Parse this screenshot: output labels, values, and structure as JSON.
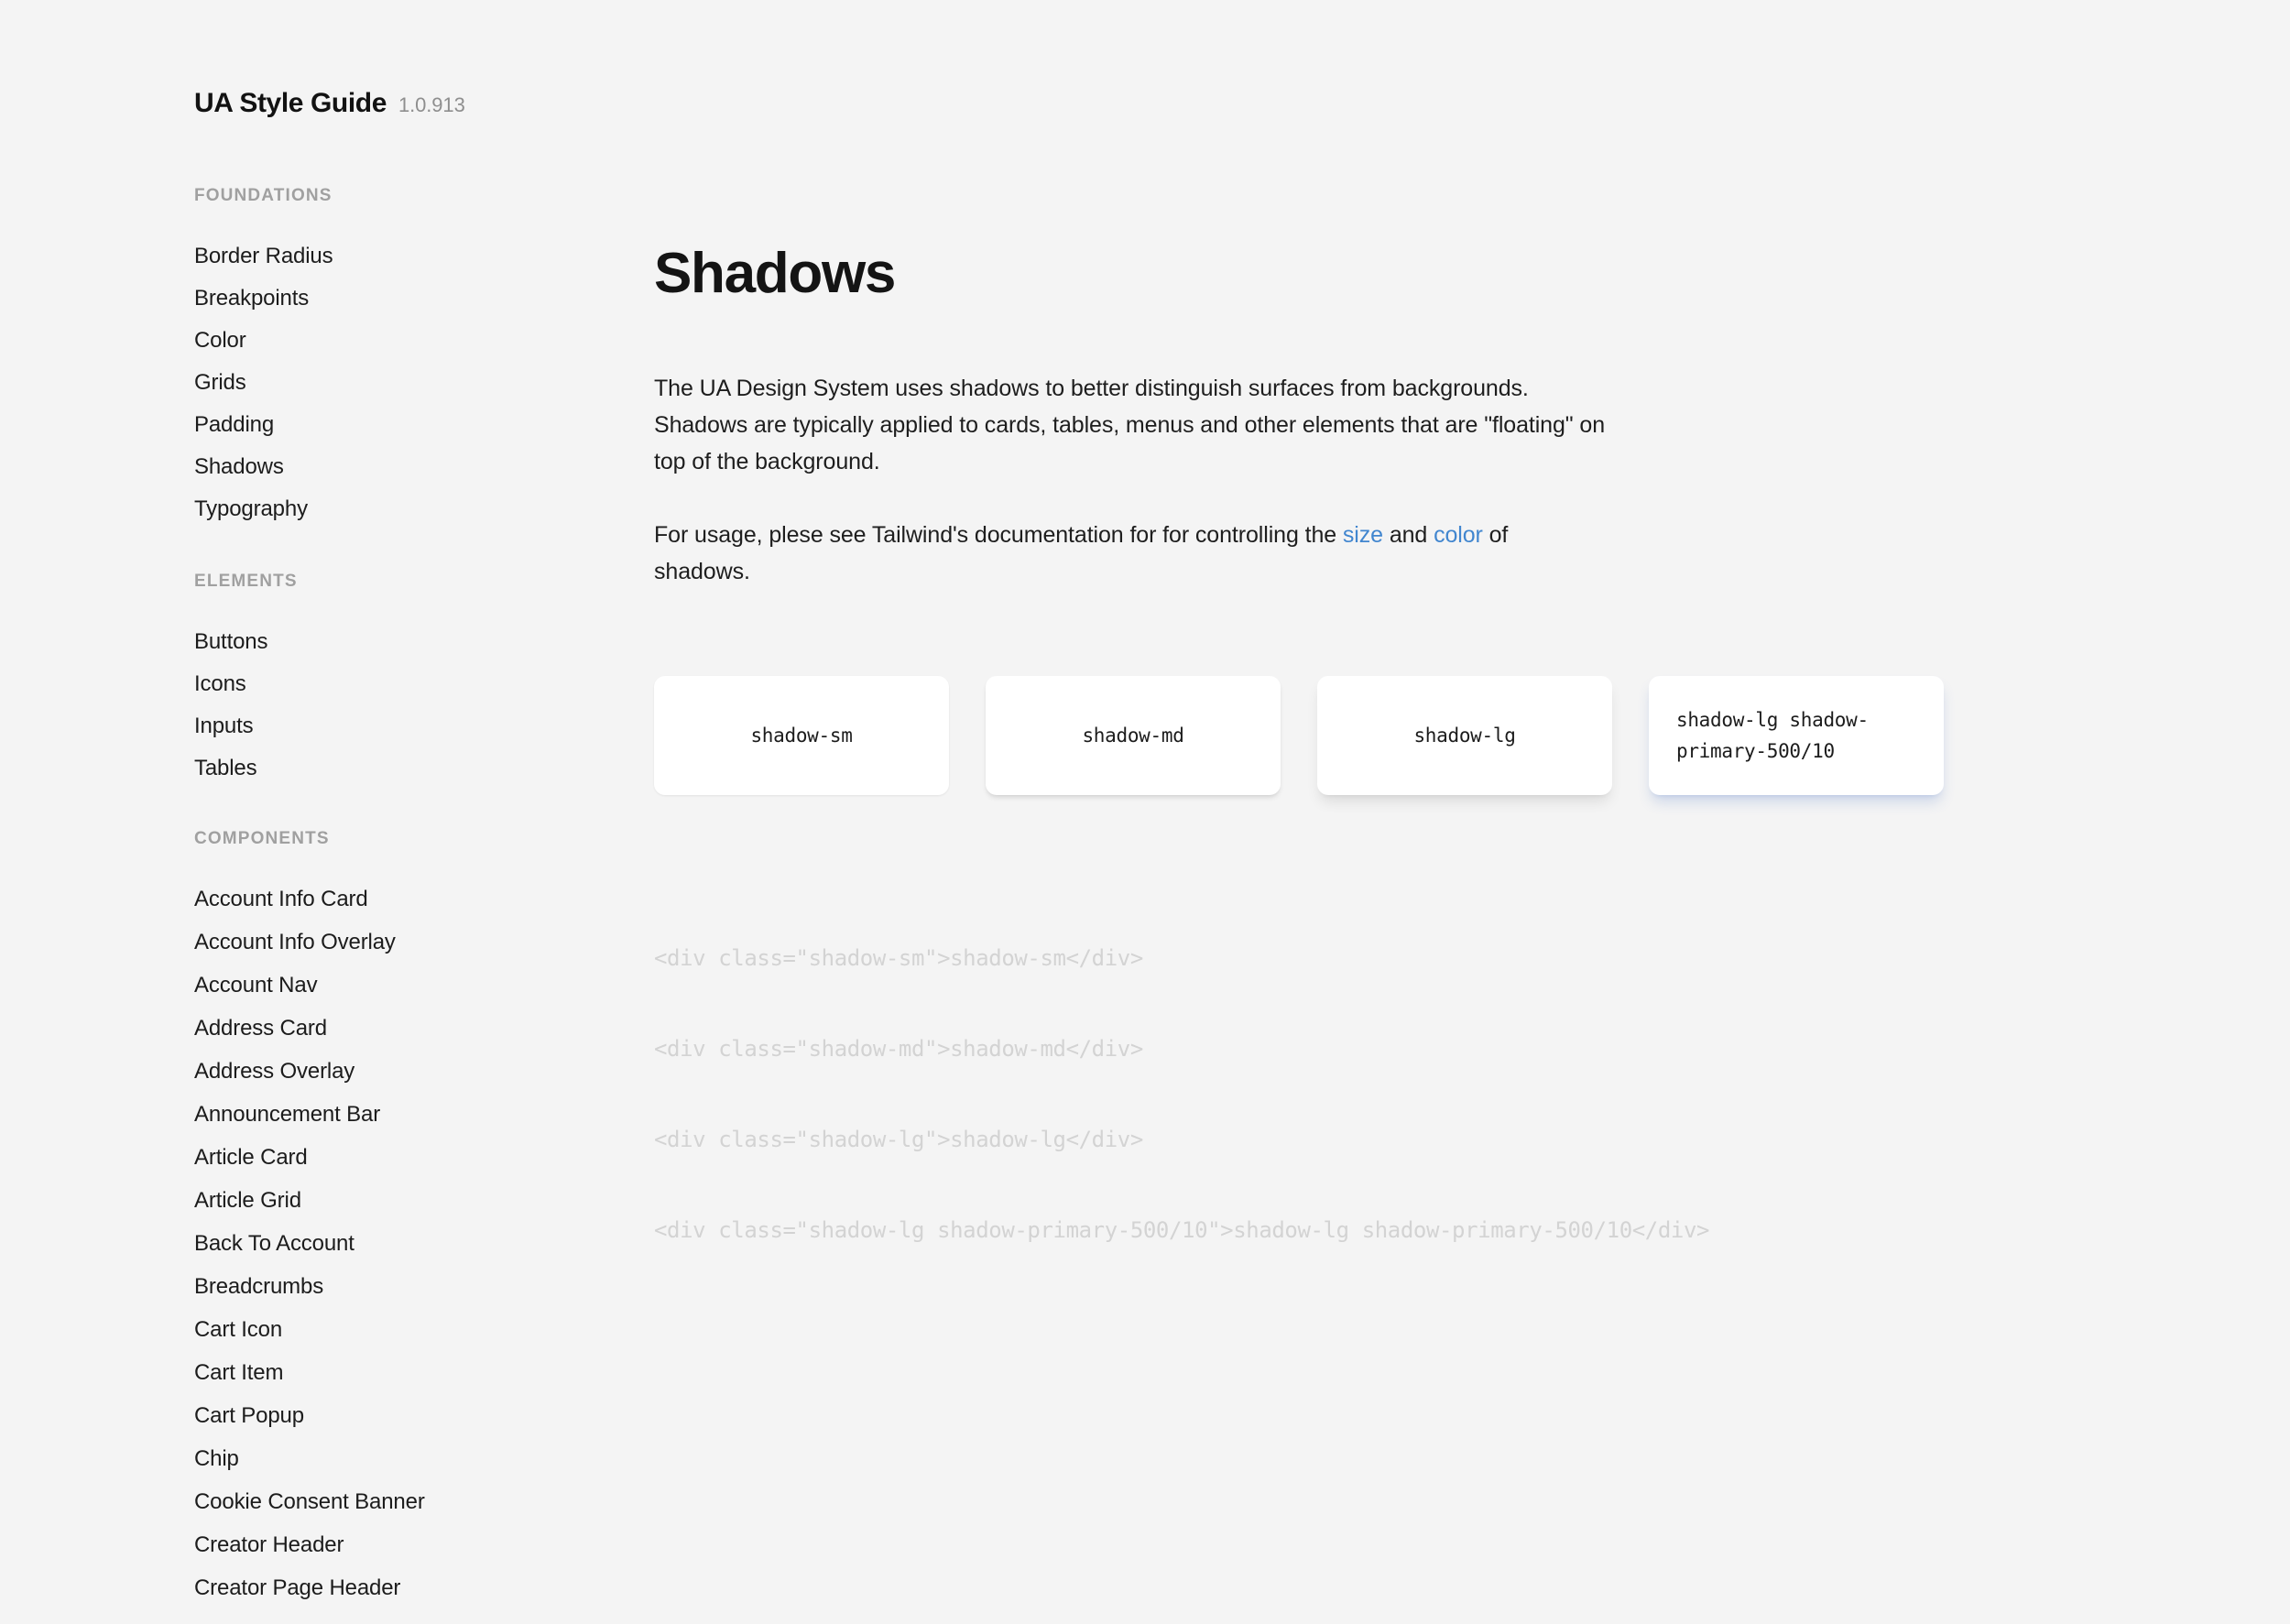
{
  "brand": {
    "title": "UA Style Guide",
    "version": "1.0.913"
  },
  "sidebar": {
    "sections": [
      {
        "heading": "FOUNDATIONS",
        "items": [
          "Border Radius",
          "Breakpoints",
          "Color",
          "Grids",
          "Padding",
          "Shadows",
          "Typography"
        ]
      },
      {
        "heading": "ELEMENTS",
        "items": [
          "Buttons",
          "Icons",
          "Inputs",
          "Tables"
        ]
      },
      {
        "heading": "COMPONENTS",
        "items": [
          "Account Info Card",
          "Account Info Overlay",
          "Account Nav",
          "Address Card",
          "Address Overlay",
          "Announcement Bar",
          "Article Card",
          "Article Grid",
          "Back To Account",
          "Breadcrumbs",
          "Cart Icon",
          "Cart Item",
          "Cart Popup",
          "Chip",
          "Cookie Consent Banner",
          "Creator Header",
          "Creator Page Header"
        ]
      }
    ]
  },
  "main": {
    "title": "Shadows",
    "paragraph_1": "The UA Design System uses shadows to better distinguish surfaces from backgrounds. Shadows are typically applied to cards, tables, menus and other elements that are \"floating\" on top of the background.",
    "paragraph_2": {
      "before_size": "For usage, plese see Tailwind's documentation for for controlling the ",
      "link_size": "size",
      "between": " and ",
      "link_color": "color",
      "after_color": " of shadows."
    },
    "cards": [
      {
        "label": "shadow-sm"
      },
      {
        "label": "shadow-md"
      },
      {
        "label": "shadow-lg"
      },
      {
        "label": "shadow-lg shadow-primary-500/10"
      }
    ],
    "code_lines": [
      "<div class=\"shadow-sm\">shadow-sm</div>",
      "<div class=\"shadow-md\">shadow-md</div>",
      "<div class=\"shadow-lg\">shadow-lg</div>",
      "<div class=\"shadow-lg shadow-primary-500/10\">shadow-lg shadow-primary-500/10</div>"
    ]
  },
  "colors": {
    "background": "#f4f4f4",
    "card_surface": "#ffffff",
    "text_primary": "#1a1a1a",
    "text_muted": "#a0a0a0",
    "link": "#4186cf",
    "code_text": "#d3d3d3",
    "primary_500": "#3b6ac4"
  }
}
